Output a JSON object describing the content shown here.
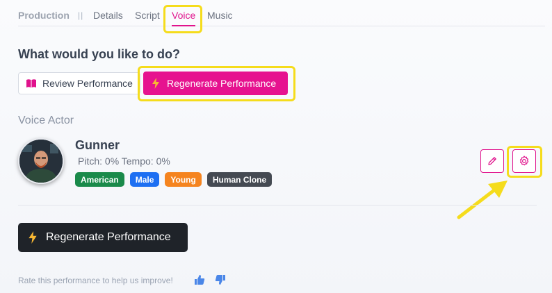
{
  "tabs": {
    "production": "Production",
    "separator": "||",
    "details": "Details",
    "script": "Script",
    "voice": "Voice",
    "music": "Music"
  },
  "question": "What would you like to do?",
  "actions": {
    "review_label": "Review Performance",
    "regenerate_label": "Regenerate Performance"
  },
  "voice_actor": {
    "section_label": "Voice Actor",
    "name": "Gunner",
    "meta": "Pitch: 0% Tempo: 0%",
    "tags": [
      {
        "label": "American",
        "color": "#1a8a4a"
      },
      {
        "label": "Male",
        "color": "#1d6ff2"
      },
      {
        "label": "Young",
        "color": "#f5841f"
      },
      {
        "label": "Human Clone",
        "color": "#454a52"
      }
    ]
  },
  "footer": {
    "regenerate_label": "Regenerate Performance",
    "rate_text": "Rate this performance to help us improve!"
  },
  "colors": {
    "accent": "#e6128f",
    "highlight": "#f5dc1c",
    "dark_button": "#1f2329",
    "thumb": "#4a86e8"
  },
  "icons": {
    "review": "book-open-icon",
    "regenerate": "lightning-bolt-icon",
    "edit": "pencil-icon",
    "settings": "gear-icon",
    "like": "thumbs-up-icon",
    "dislike": "thumbs-down-icon"
  }
}
